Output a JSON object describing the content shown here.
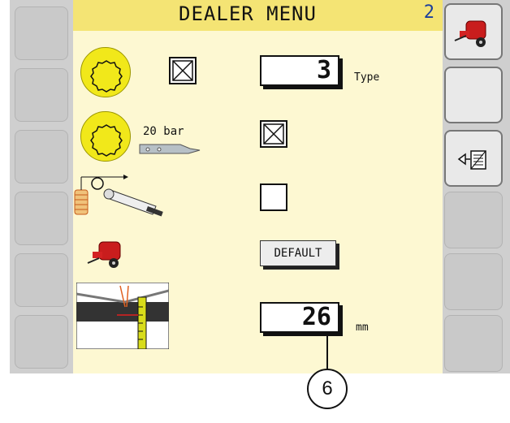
{
  "header": {
    "title": "DEALER MENU",
    "page_number": "2"
  },
  "rows": {
    "type": {
      "value": "3",
      "unit": "Type"
    },
    "pressure": {
      "label": "20 bar"
    },
    "default_button": {
      "label": "DEFAULT"
    },
    "measure": {
      "value": "26",
      "unit": "mm"
    }
  },
  "checkboxes": {
    "row1": true,
    "row2": true,
    "row3": false
  },
  "callout": {
    "label": "6"
  },
  "colors": {
    "screen_bg": "#fdf8d2",
    "title_bg": "#f4e474",
    "accent_yellow": "#f1e81a",
    "page_blue": "#1c3f9c",
    "baler_red": "#c91d1d"
  },
  "icons": {
    "left_softkeys": [
      "blank",
      "blank",
      "blank",
      "blank",
      "blank",
      "blank"
    ],
    "right_softkeys": [
      "baler-icon",
      "blank",
      "exit-page-icon",
      "blank",
      "blank",
      "blank"
    ]
  }
}
